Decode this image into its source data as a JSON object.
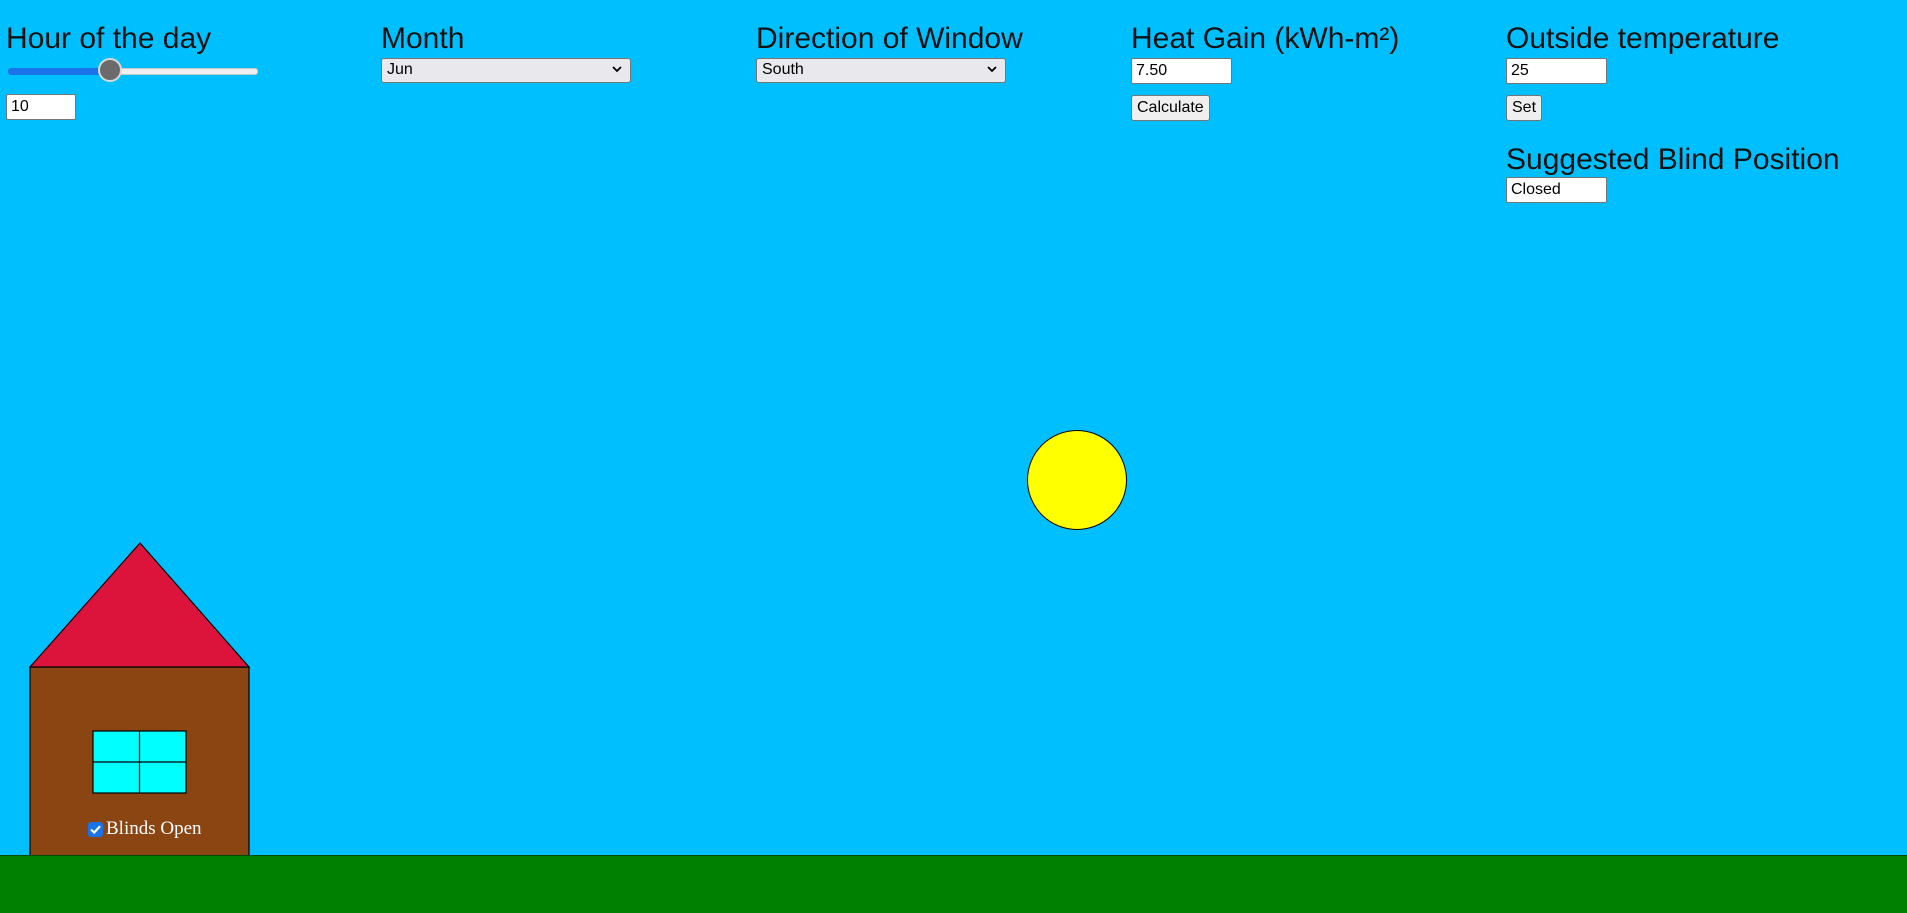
{
  "controls": {
    "hour": {
      "heading": "Hour of the day",
      "slider_fraction": 0.4,
      "value": "10"
    },
    "month": {
      "heading": "Month",
      "selected": "Jun"
    },
    "direction": {
      "heading": "Direction of Window",
      "selected": "South"
    },
    "heat_gain": {
      "heading": "Heat Gain (kWh-m²)",
      "value": "7.50",
      "button_label": "Calculate"
    },
    "outside_temp": {
      "heading": "Outside temperature",
      "value": "25",
      "button_label": "Set"
    },
    "blind_position": {
      "heading": "Suggested Blind Position",
      "value": "Closed"
    }
  },
  "scene": {
    "blinds_checkbox_label": "Blinds Open",
    "blinds_checked": true,
    "colors": {
      "sky": "#00bfff",
      "ground": "#008000",
      "sun": "#ffff00",
      "roof": "#dc143c",
      "wall": "#8b4513",
      "window": "#00ffff",
      "slider_accent": "#1a73e8"
    }
  }
}
